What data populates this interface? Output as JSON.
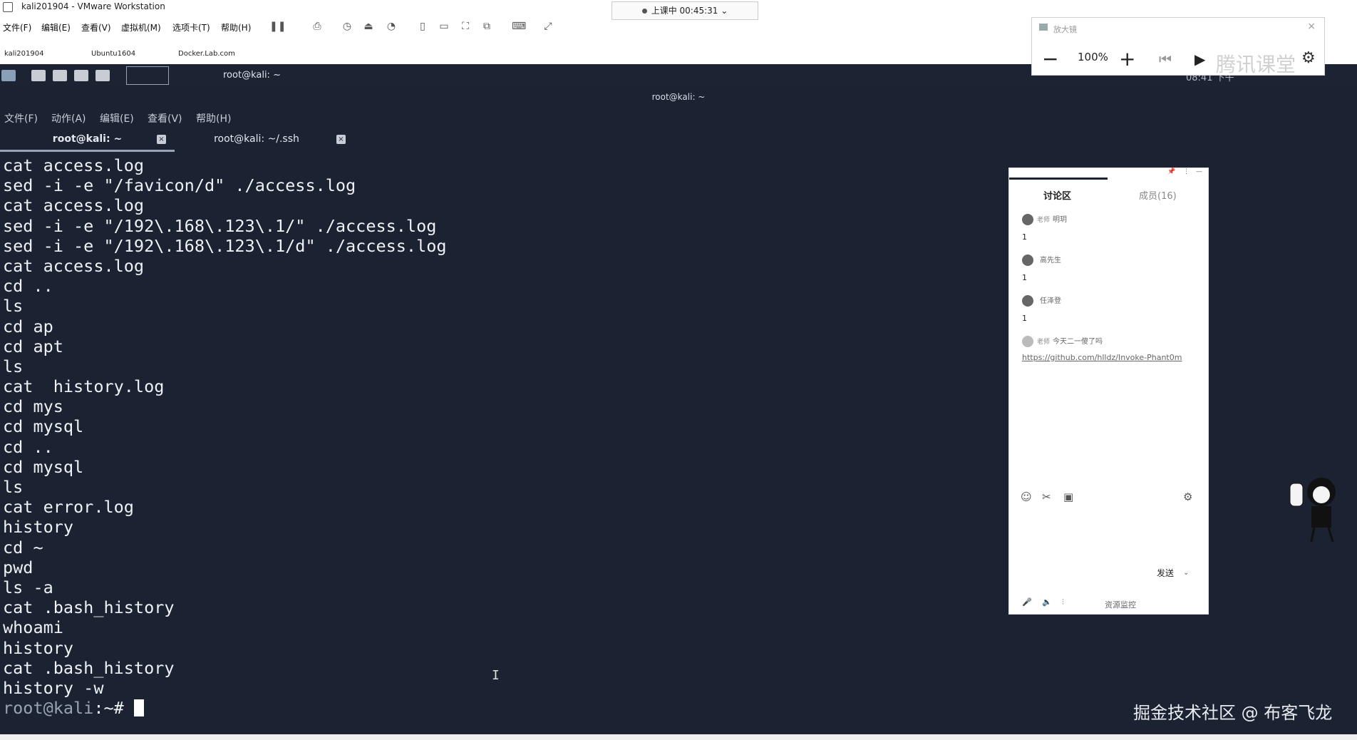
{
  "vm": {
    "title": "kali201904 - VMware Workstation",
    "menus": [
      "文件(F)",
      "编辑(E)",
      "查看(V)",
      "虚拟机(M)",
      "选项卡(T)",
      "帮助(H)"
    ],
    "recording_status": "上课中 00:45:31",
    "tabs": [
      "kali201904",
      "Ubuntu1604",
      "Docker.Lab.com"
    ]
  },
  "kali_panel": {
    "window_title": "root@kali: ~",
    "clock": "08:41 下午"
  },
  "terminal": {
    "window_title": "root@kali: ~",
    "menu": [
      "文件(F)",
      "动作(A)",
      "编辑(E)",
      "查看(V)",
      "帮助(H)"
    ],
    "tabs": [
      "root@kali: ~",
      "root@kali: ~/.ssh"
    ],
    "lines": [
      "cat access.log",
      "sed -i -e \"/favicon/d\" ./access.log",
      "cat access.log",
      "sed -i -e \"/192\\.168\\.123\\.1/\" ./access.log",
      "sed -i -e \"/192\\.168\\.123\\.1/d\" ./access.log",
      "cat access.log",
      "cd ..",
      "ls",
      "cd ap",
      "cd apt",
      "ls",
      "cat  history.log",
      "cd mys",
      "cd mysql",
      "cd ..",
      "cd mysql",
      "ls",
      "cat error.log",
      "history",
      "cd ~",
      "pwd",
      "ls -a",
      "cat .bash_history",
      "whoami",
      "history",
      "cat .bash_history",
      "history -w"
    ],
    "prompt_user": "root@kali",
    "prompt_rest": ":~# "
  },
  "magnifier": {
    "title": "放大镜",
    "zoom": "100%",
    "brand": "腾讯课堂"
  },
  "chat": {
    "tab_discussion": "讨论区",
    "tab_members": "成员(16)",
    "messages": [
      {
        "badge": "老师",
        "name": "明玥",
        "text": "1"
      },
      {
        "badge": "",
        "name": "高先生",
        "text": "1"
      },
      {
        "badge": "",
        "name": "任泽登",
        "text": "1"
      },
      {
        "badge": "老师",
        "name": "今天二一傻了吗",
        "text": "https://github.com/hlldz/Invoke-Phant0m"
      }
    ],
    "send": "发送",
    "status": "资源监控"
  },
  "watermark": "掘金技术社区 @ 布客飞龙",
  "icons": {
    "emoji": "smile-icon",
    "scissors": "scissors-icon",
    "image": "image-icon",
    "settings": "settings-icon",
    "mic": "microphone-icon",
    "speaker": "speaker-icon"
  }
}
